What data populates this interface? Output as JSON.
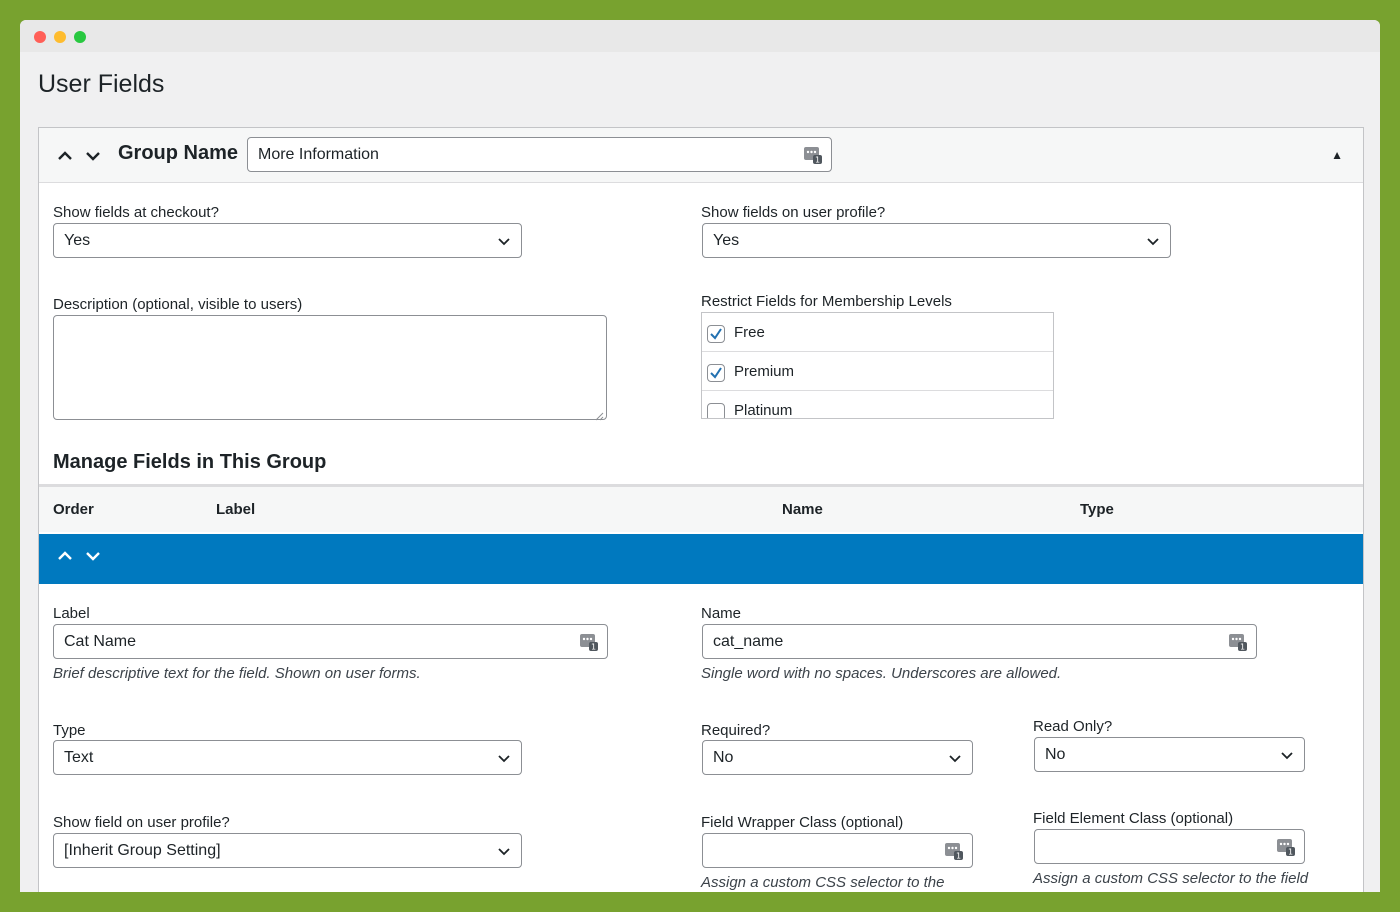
{
  "page": {
    "title": "User Fields"
  },
  "group": {
    "name_label": "Group Name",
    "name_value": "More Information",
    "show_checkout_label": "Show fields at checkout?",
    "show_checkout_value": "Yes",
    "show_profile_label": "Show fields on user profile?",
    "show_profile_value": "Yes",
    "description_label": "Description (optional, visible to users)",
    "levels_label": "Restrict Fields for Membership Levels",
    "levels": [
      {
        "label": "Free",
        "checked": true
      },
      {
        "label": "Premium",
        "checked": true
      },
      {
        "label": "Platinum",
        "checked": false
      }
    ]
  },
  "manage": {
    "title": "Manage Fields in This Group",
    "columns": {
      "order": "Order",
      "label": "Label",
      "name": "Name",
      "type": "Type"
    }
  },
  "field": {
    "label_label": "Label",
    "label_value": "Cat Name",
    "label_help": "Brief descriptive text for the field. Shown on user forms.",
    "name_label": "Name",
    "name_value": "cat_name",
    "name_help": "Single word with no spaces. Underscores are allowed.",
    "type_label": "Type",
    "type_value": "Text",
    "required_label": "Required?",
    "required_value": "No",
    "readonly_label": "Read Only?",
    "readonly_value": "No",
    "profile_label": "Show field on user profile?",
    "profile_value": "[Inherit Group Setting]",
    "wrapper_label": "Field Wrapper Class (optional)",
    "wrapper_help": "Assign a custom CSS selector to the",
    "element_label": "Field Element Class (optional)",
    "element_help": "Assign a custom CSS selector to the field"
  },
  "colors": {
    "accent": "#0079bf",
    "frame": "#78a22f",
    "check": "#2271b1"
  }
}
